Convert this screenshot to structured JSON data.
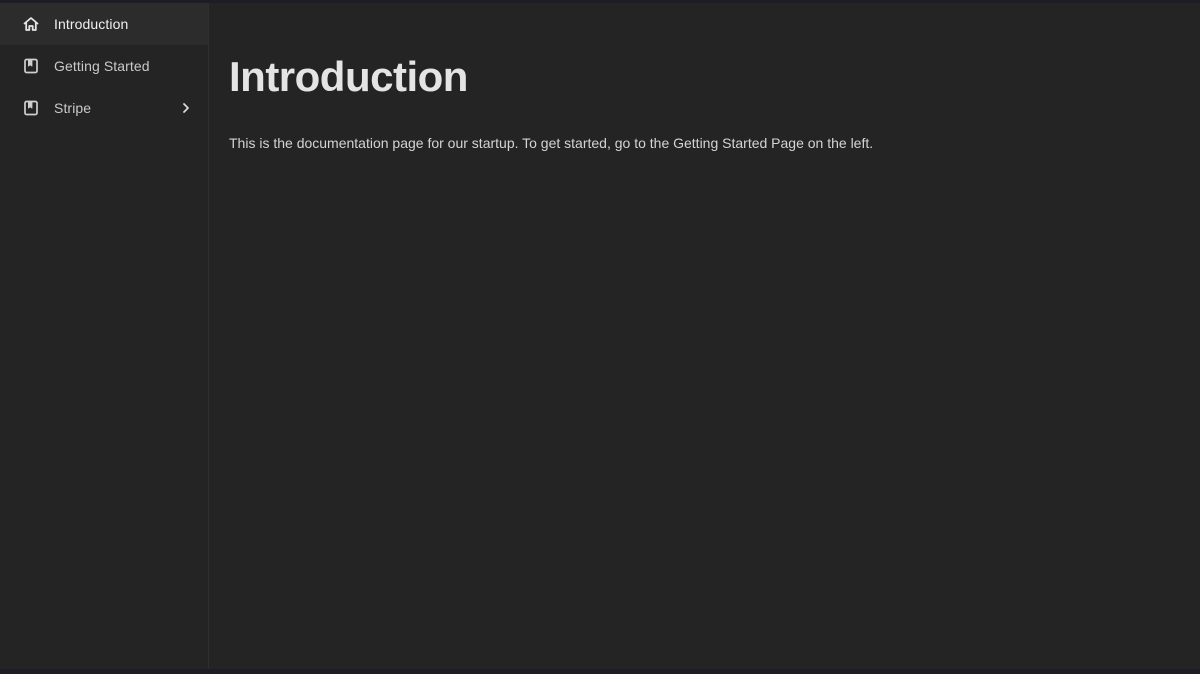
{
  "sidebar": {
    "items": [
      {
        "label": "Introduction",
        "icon": "home-icon",
        "active": true
      },
      {
        "label": "Getting Started",
        "icon": "book-icon",
        "active": false
      },
      {
        "label": "Stripe",
        "icon": "book-icon",
        "active": false,
        "expandable": true
      }
    ]
  },
  "main": {
    "title": "Introduction",
    "body": "This is the documentation page for our startup. To get started, go to the Getting Started Page on the left."
  },
  "colors": {
    "background": "#242424",
    "sidebar_active": "#2c2c2c",
    "text_primary": "#e4e4e4",
    "text_secondary": "#c9c9c9"
  }
}
